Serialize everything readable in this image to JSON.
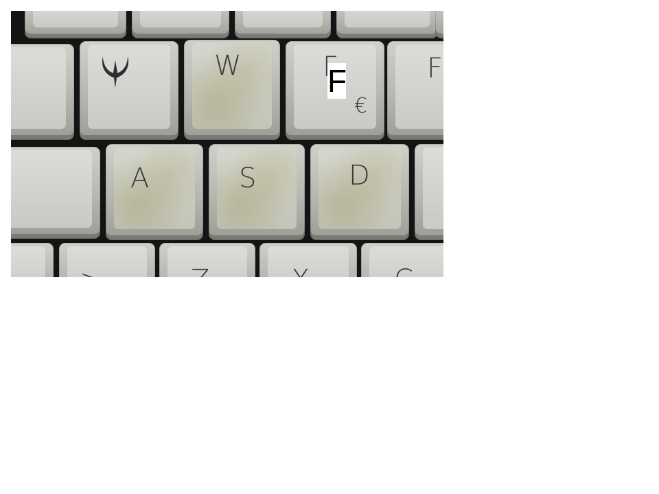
{
  "photo": {
    "subject": "keyboard keys close-up",
    "keys": {
      "w": "W",
      "e": "F",
      "r": "F",
      "a": "A",
      "s": "S",
      "d": "D",
      "z": "Z",
      "x": "X",
      "c": "C",
      "less": ">"
    },
    "euro_symbol": "€",
    "quake_logo_icon": "quake-logo-icon",
    "overlay_text": "F"
  }
}
